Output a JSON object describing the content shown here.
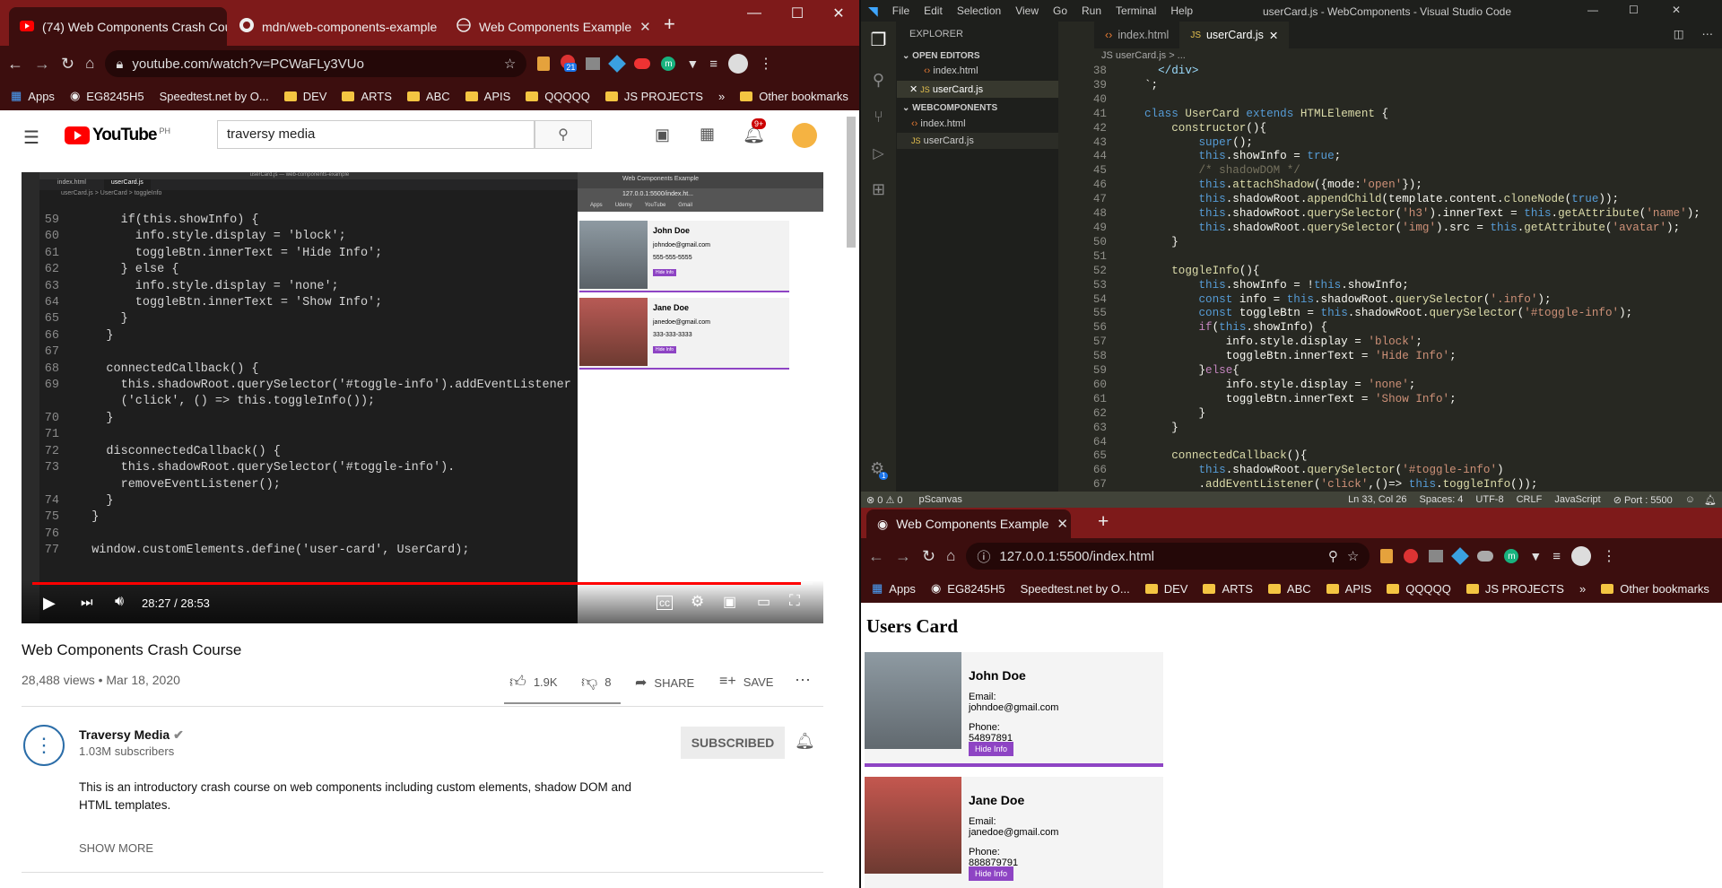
{
  "left_browser": {
    "tabs": [
      {
        "title": "(74) Web Components Crash Cou",
        "favicon": "youtube-icon"
      },
      {
        "title": "mdn/web-components-example",
        "favicon": "github-icon"
      },
      {
        "title": "Web Components Example",
        "favicon": "globe-icon"
      }
    ],
    "url": "youtube.com/watch?v=PCWaFLy3VUo",
    "bookmarks": [
      "Apps",
      "EG8245H5",
      "Speedtest.net by O...",
      "DEV",
      "ARTS",
      "ABC",
      "APIS",
      "QQQQQ",
      "JS PROJECTS"
    ],
    "other_bookmarks": "Other bookmarks",
    "extension_badge": "21"
  },
  "youtube": {
    "logo": "YouTube",
    "region": "PH",
    "search_value": "traversy media",
    "notif_count": "9+",
    "video": {
      "time": "28:27 / 28:53",
      "progress": 0.985,
      "inner_tabs": [
        "index.html",
        "userCard.js"
      ],
      "inner_breadcrumb": "userCard.js > UserCard > toggleInfo",
      "inner_title": "userCard.js — web-components-example",
      "code_lines": [
        {
          "n": "59",
          "t": "      if(this.showInfo) {"
        },
        {
          "n": "60",
          "t": "        info.style.display = 'block';"
        },
        {
          "n": "61",
          "t": "        toggleBtn.innerText = 'Hide Info';"
        },
        {
          "n": "62",
          "t": "      } else {"
        },
        {
          "n": "63",
          "t": "        info.style.display = 'none';"
        },
        {
          "n": "64",
          "t": "        toggleBtn.innerText = 'Show Info';"
        },
        {
          "n": "65",
          "t": "      }"
        },
        {
          "n": "66",
          "t": "    }"
        },
        {
          "n": "67",
          "t": ""
        },
        {
          "n": "68",
          "t": "    connectedCallback() {"
        },
        {
          "n": "69",
          "t": "      this.shadowRoot.querySelector('#toggle-info').addEventListener"
        },
        {
          "n": "",
          "t": "      ('click', () => this.toggleInfo());"
        },
        {
          "n": "70",
          "t": "    }"
        },
        {
          "n": "71",
          "t": ""
        },
        {
          "n": "72",
          "t": "    disconnectedCallback() {"
        },
        {
          "n": "73",
          "t": "      this.shadowRoot.querySelector('#toggle-info')."
        },
        {
          "n": "",
          "t": "      removeEventListener();"
        },
        {
          "n": "74",
          "t": "    }"
        },
        {
          "n": "75",
          "t": "  }"
        },
        {
          "n": "76",
          "t": ""
        },
        {
          "n": "77",
          "t": "  window.customElements.define('user-card', UserCard);"
        }
      ],
      "mini_browser_tab": "Web Components Example",
      "mini_url": "127.0.0.1:5500/index.ht...",
      "mini_bookmarks": [
        "Apps",
        "Udemy",
        "YouTube",
        "Gmail"
      ],
      "mini_cards": [
        {
          "name": "John Doe",
          "email": "johndoe@gmail.com",
          "phone": "555-555-5555",
          "button": "Hide Info"
        },
        {
          "name": "Jane Doe",
          "email": "janedoe@gmail.com",
          "phone": "333-333-3333",
          "button": "Hide Info"
        }
      ]
    },
    "title": "Web Components Crash Course",
    "views": "28,488 views • Mar 18, 2020",
    "likes": "1.9K",
    "dislikes": "8",
    "share": "SHARE",
    "save": "SAVE",
    "channel": "Traversy Media",
    "subscribers": "1.03M subscribers",
    "subscribed_label": "SUBSCRIBED",
    "description": "This is an introductory crash course on web components including custom elements, shadow DOM and HTML templates.",
    "show_more": "SHOW MORE"
  },
  "vscode": {
    "window_title": "userCard.js - WebComponents - Visual Studio Code",
    "menu": [
      "File",
      "Edit",
      "Selection",
      "View",
      "Go",
      "Run",
      "Terminal",
      "Help"
    ],
    "explorer_label": "EXPLORER",
    "open_editors_label": "OPEN EDITORS",
    "open_editors": [
      "index.html",
      "userCard.js"
    ],
    "workspace_label": "WEBCOMPONENTS",
    "workspace_files": [
      "index.html",
      "userCard.js"
    ],
    "tabs": [
      "index.html",
      "userCard.js"
    ],
    "breadcrumb": "JS userCard.js > ...",
    "line_numbers": [
      "38",
      "39",
      "40",
      "41",
      "42",
      "43",
      "44",
      "45",
      "46",
      "47",
      "48",
      "49",
      "50",
      "51",
      "52",
      "53",
      "54",
      "55",
      "56",
      "57",
      "58",
      "59",
      "60",
      "61",
      "62",
      "63",
      "64",
      "65",
      "66",
      "67"
    ],
    "status": {
      "errors": "0",
      "warnings": "0",
      "extension": "pScanvas",
      "position": "Ln 33, Col 26",
      "spaces": "Spaces: 4",
      "encoding": "UTF-8",
      "eol": "CRLF",
      "language": "JavaScript",
      "port": "Port : 5500",
      "settings_badge": "1"
    }
  },
  "right_browser": {
    "tab_title": "Web Components Example",
    "url": "127.0.0.1:5500/index.html",
    "bookmarks": [
      "Apps",
      "EG8245H5",
      "Speedtest.net by O...",
      "DEV",
      "ARTS",
      "ABC",
      "APIS",
      "QQQQQ",
      "JS PROJECTS"
    ],
    "other_bookmarks": "Other bookmarks",
    "heading": "Users Card",
    "cards": [
      {
        "name": "John Doe",
        "email_label": "Email:",
        "email": "johndoe@gmail.com",
        "phone_label": "Phone:",
        "phone": "54897891",
        "button": "Hide Info"
      },
      {
        "name": "Jane Doe",
        "email_label": "Email:",
        "email": "janedoe@gmail.com",
        "phone_label": "Phone:",
        "phone": "888879791",
        "button": "Hide Info"
      }
    ]
  },
  "colors": {
    "chrome_frame": "#7e1a1a",
    "youtube_red": "#ff0000",
    "card_accent": "#8e44c4",
    "vscode_bg": "#272822"
  }
}
